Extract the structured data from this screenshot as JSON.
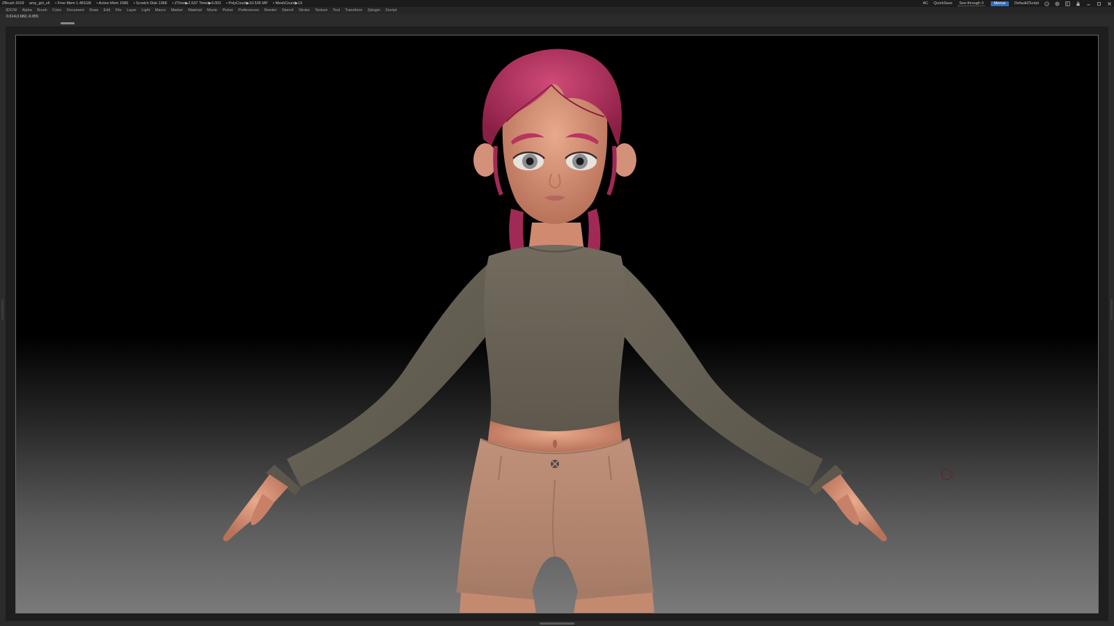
{
  "titlebar": {
    "app": "ZBrush 2019",
    "file": "amy_girl_v6",
    "free_mem": "• Free Mem 1.481GB",
    "active_mem": "• Active Mem 1586",
    "scratch": "• Scratch Disk 1368",
    "ztime": "• ZTime▶2.537 Timer▶0.002",
    "polycount": "• PolyCount▶10.536 MP",
    "meshcount": "• MeshCount▶13",
    "ac": "AC",
    "quicksave": "QuickSave",
    "see_through": "See-through  0",
    "see_through_level": 0,
    "menus": "Menus",
    "script": "DefaultZScript"
  },
  "menubar": {
    "items": [
      "3DCW",
      "Alpha",
      "Brush",
      "Color",
      "Document",
      "Draw",
      "Edit",
      "File",
      "Layer",
      "Light",
      "Macro",
      "Marker",
      "Material",
      "Movie",
      "Picker",
      "Preferences",
      "Render",
      "Stencil",
      "Stroke",
      "Texture",
      "Tool",
      "Transform",
      "Zplugin",
      "Zscript"
    ]
  },
  "info": {
    "coords": "0.614,0.682,-0.055"
  },
  "icons": {
    "help": "help-icon",
    "settings": "settings-icon",
    "layout": "layout-icon",
    "lock": "lock-icon",
    "minimize": "minimize-icon",
    "maximize": "maximize-icon",
    "close": "close-icon"
  },
  "colors": {
    "hair": "#b8345f",
    "skin": "#d99277",
    "shirt": "#6b6558",
    "shorts": "#b88a70",
    "accent_blue": "#2f6fbf"
  }
}
